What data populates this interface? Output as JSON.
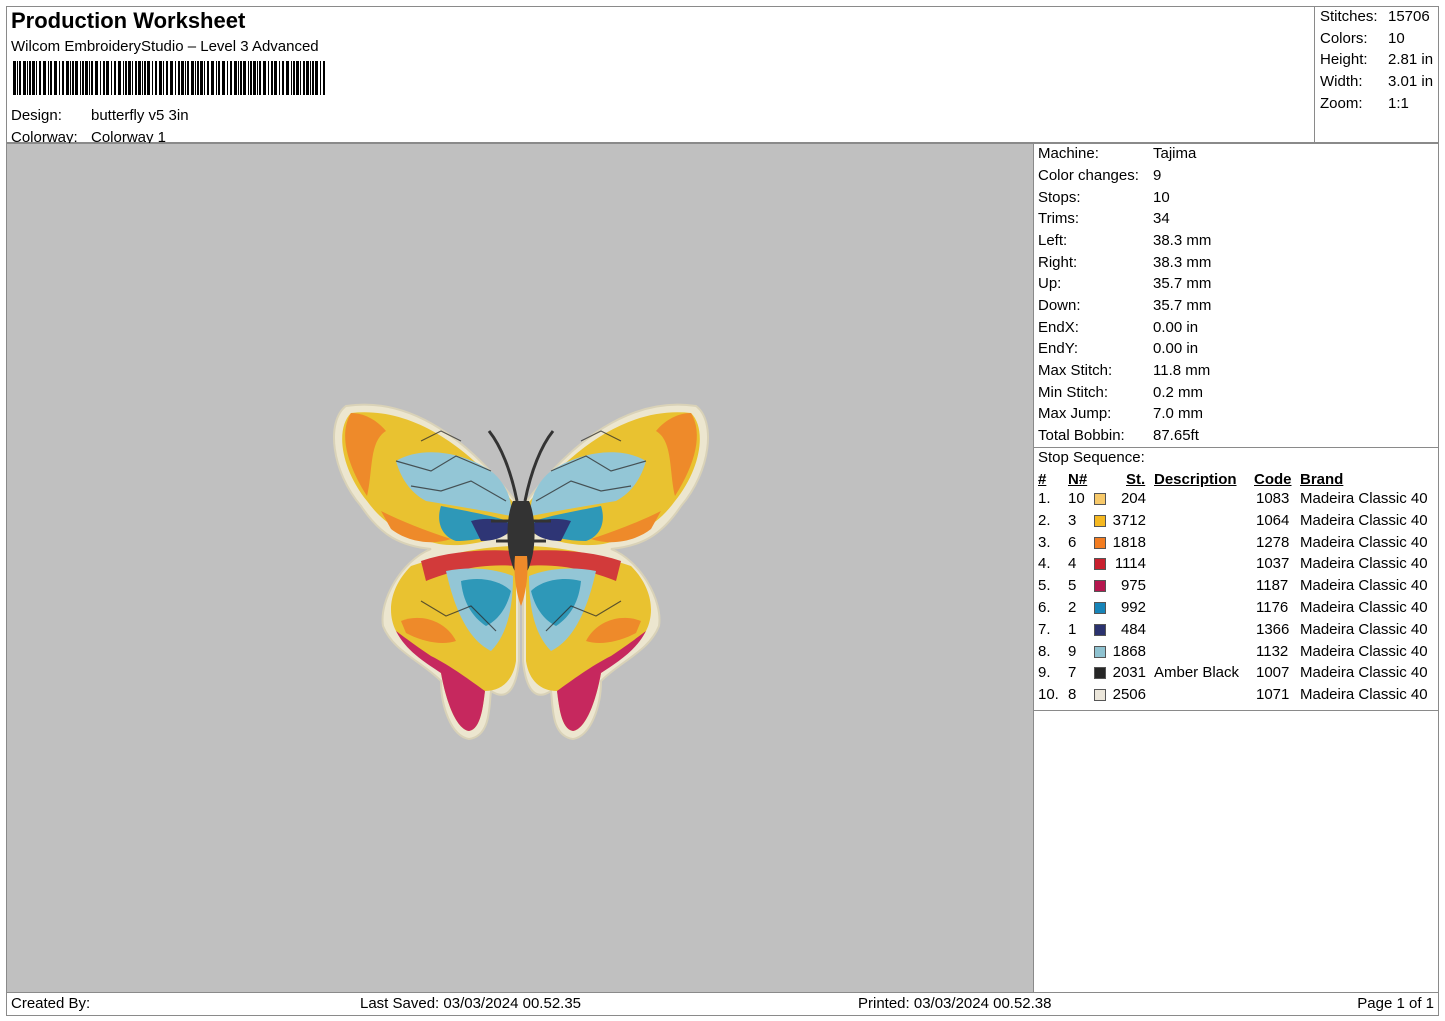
{
  "header": {
    "title": "Production Worksheet",
    "subtitle": "Wilcom EmbroideryStudio – Level 3 Advanced",
    "design_label": "Design:",
    "design_value": "butterfly v5 3in",
    "colorway_label": "Colorway:",
    "colorway_value": "Colorway 1"
  },
  "stats": [
    {
      "label": "Stitches:",
      "value": "15706"
    },
    {
      "label": "Colors:",
      "value": "10"
    },
    {
      "label": "Height:",
      "value": "2.81 in"
    },
    {
      "label": "Width:",
      "value": "3.01 in"
    },
    {
      "label": "Zoom:",
      "value": "1:1"
    }
  ],
  "machine": [
    {
      "label": "Machine:",
      "value": "Tajima"
    },
    {
      "label": "Color changes:",
      "value": "9"
    },
    {
      "label": "Stops:",
      "value": "10"
    },
    {
      "label": "Trims:",
      "value": "34"
    },
    {
      "label": "Left:",
      "value": "38.3 mm"
    },
    {
      "label": "Right:",
      "value": "38.3 mm"
    },
    {
      "label": "Up:",
      "value": "35.7 mm"
    },
    {
      "label": "Down:",
      "value": "35.7 mm"
    },
    {
      "label": "EndX:",
      "value": "0.00 in"
    },
    {
      "label": "EndY:",
      "value": "0.00 in"
    },
    {
      "label": "Max Stitch:",
      "value": "11.8 mm"
    },
    {
      "label": "Min Stitch:",
      "value": "0.2 mm"
    },
    {
      "label": "Max Jump:",
      "value": "7.0 mm"
    },
    {
      "label": "Total Bobbin:",
      "value": "87.65ft"
    }
  ],
  "stop_sequence": {
    "label": "Stop Sequence:",
    "headers": {
      "num": "#",
      "n": "N#",
      "st": "St.",
      "desc": "Description",
      "code": "Code",
      "brand": "Brand"
    },
    "rows": [
      {
        "num": "1.",
        "n": "10",
        "color": "#f7c96a",
        "st": "204",
        "desc": "",
        "code": "1083",
        "brand": "Madeira Classic 40"
      },
      {
        "num": "2.",
        "n": "3",
        "color": "#f5b820",
        "st": "3712",
        "desc": "",
        "code": "1064",
        "brand": "Madeira Classic 40"
      },
      {
        "num": "3.",
        "n": "6",
        "color": "#f27c21",
        "st": "1818",
        "desc": "",
        "code": "1278",
        "brand": "Madeira Classic 40"
      },
      {
        "num": "4.",
        "n": "4",
        "color": "#c8202e",
        "st": "1114",
        "desc": "",
        "code": "1037",
        "brand": "Madeira Classic 40"
      },
      {
        "num": "5.",
        "n": "5",
        "color": "#b5174f",
        "st": "975",
        "desc": "",
        "code": "1187",
        "brand": "Madeira Classic 40"
      },
      {
        "num": "6.",
        "n": "2",
        "color": "#1784b8",
        "st": "992",
        "desc": "",
        "code": "1176",
        "brand": "Madeira Classic 40"
      },
      {
        "num": "7.",
        "n": "1",
        "color": "#2b326e",
        "st": "484",
        "desc": "",
        "code": "1366",
        "brand": "Madeira Classic 40"
      },
      {
        "num": "8.",
        "n": "9",
        "color": "#8fc2d0",
        "st": "1868",
        "desc": "",
        "code": "1132",
        "brand": "Madeira Classic 40"
      },
      {
        "num": "9.",
        "n": "7",
        "color": "#262626",
        "st": "2031",
        "desc": "Amber Black",
        "code": "1007",
        "brand": "Madeira Classic 40"
      },
      {
        "num": "10.",
        "n": "8",
        "color": "#ebe6da",
        "st": "2506",
        "desc": "",
        "code": "1071",
        "brand": "Madeira Classic 40"
      }
    ]
  },
  "footer": {
    "created_by": "Created By:",
    "last_saved": "Last Saved: 03/03/2024 00.52.35",
    "printed": "Printed: 03/03/2024 00.52.38",
    "page": "Page 1 of 1"
  },
  "colors": {
    "preview_bg": "#c0c0c0",
    "outline": "#ece6cf",
    "yellow": "#e9c230",
    "orange": "#ee8a2a",
    "light_blue": "#93c6d6",
    "teal": "#2e98b8",
    "red": "#d23a3a",
    "magenta": "#c6285e",
    "navy": "#2e3575",
    "black": "#333333"
  }
}
